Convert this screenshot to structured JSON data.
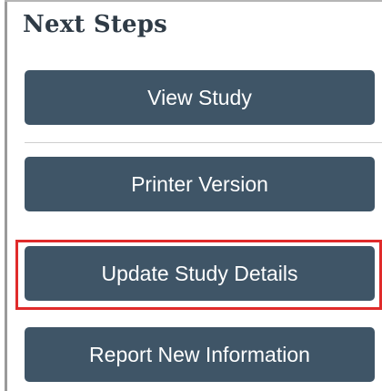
{
  "panel": {
    "title": "Next Steps"
  },
  "buttons": {
    "view_study": "View Study",
    "printer_version": "Printer Version",
    "update_study_details": "Update Study Details",
    "report_new_information": "Report New Information"
  },
  "colors": {
    "button_background": "#3f5567",
    "button_text": "#ffffff",
    "title_text": "#2f3b46",
    "highlight": "#e02b2b"
  }
}
